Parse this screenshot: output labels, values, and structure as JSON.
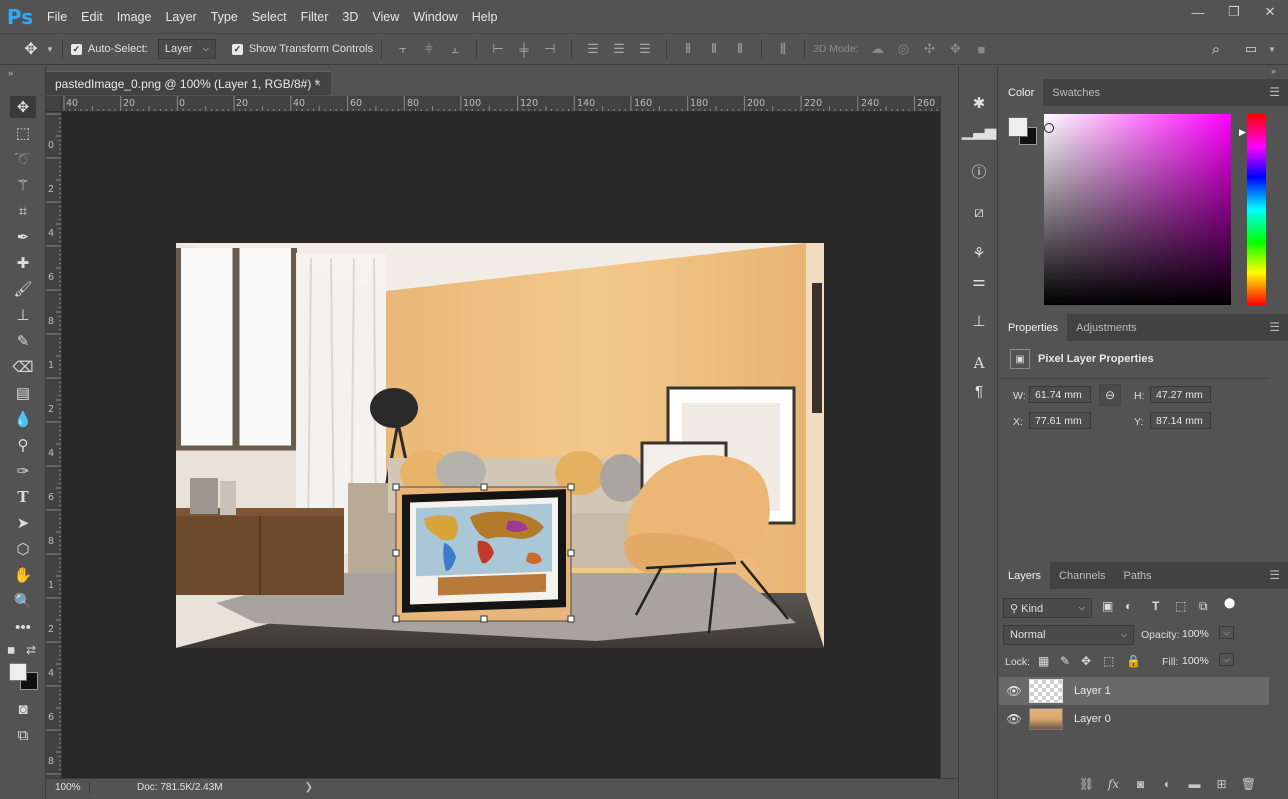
{
  "app": {
    "logo": "Ps"
  },
  "menu": [
    "File",
    "Edit",
    "Image",
    "Layer",
    "Type",
    "Select",
    "Filter",
    "3D",
    "View",
    "Window",
    "Help"
  ],
  "window_controls": {
    "minimize": "—",
    "maximize": "❐",
    "close": "✕"
  },
  "options": {
    "auto_select_label": "Auto-Select:",
    "auto_select_value": "Layer",
    "show_transform_label": "Show Transform Controls",
    "mode_3d_label": "3D Mode:"
  },
  "document": {
    "tab_title": "pastedImage_0.png @ 100% (Layer 1, RGB/8#) *",
    "close": "×"
  },
  "ruler_h": [
    "40",
    "20",
    "0",
    "20",
    "40",
    "60",
    "80",
    "100",
    "120",
    "140",
    "160",
    "180",
    "200",
    "220",
    "240",
    "260"
  ],
  "ruler_v": [
    "0",
    "2",
    "4",
    "6",
    "8",
    "1",
    "2",
    "4",
    "6",
    "8",
    "1",
    "2",
    "4",
    "6",
    "8"
  ],
  "status": {
    "zoom": "100%",
    "doc": "Doc: 781.5K/2.43M",
    "arrow": "❯"
  },
  "color_panel": {
    "tabs": [
      "Color",
      "Swatches"
    ]
  },
  "properties_panel": {
    "tabs": [
      "Properties",
      "Adjustments"
    ],
    "title": "Pixel Layer Properties",
    "w_label": "W:",
    "w_value": "61.74 mm",
    "h_label": "H:",
    "h_value": "47.27 mm",
    "x_label": "X:",
    "x_value": "77.61 mm",
    "y_label": "Y:",
    "y_value": "87.14 mm"
  },
  "layers_panel": {
    "tabs": [
      "Layers",
      "Channels",
      "Paths"
    ],
    "filter_kind": "Kind",
    "blend_mode": "Normal",
    "opacity_label": "Opacity:",
    "opacity_value": "100%",
    "lock_label": "Lock:",
    "fill_label": "Fill:",
    "fill_value": "100%",
    "layers": [
      {
        "name": "Layer 1",
        "selected": true
      },
      {
        "name": "Layer 0",
        "selected": false
      }
    ]
  },
  "colors": {
    "accent": "#31a8ff",
    "panel_bg": "#535353",
    "canvas_bg": "#282828",
    "fg_swatch": "#eeeeee",
    "bg_swatch": "#111111"
  }
}
